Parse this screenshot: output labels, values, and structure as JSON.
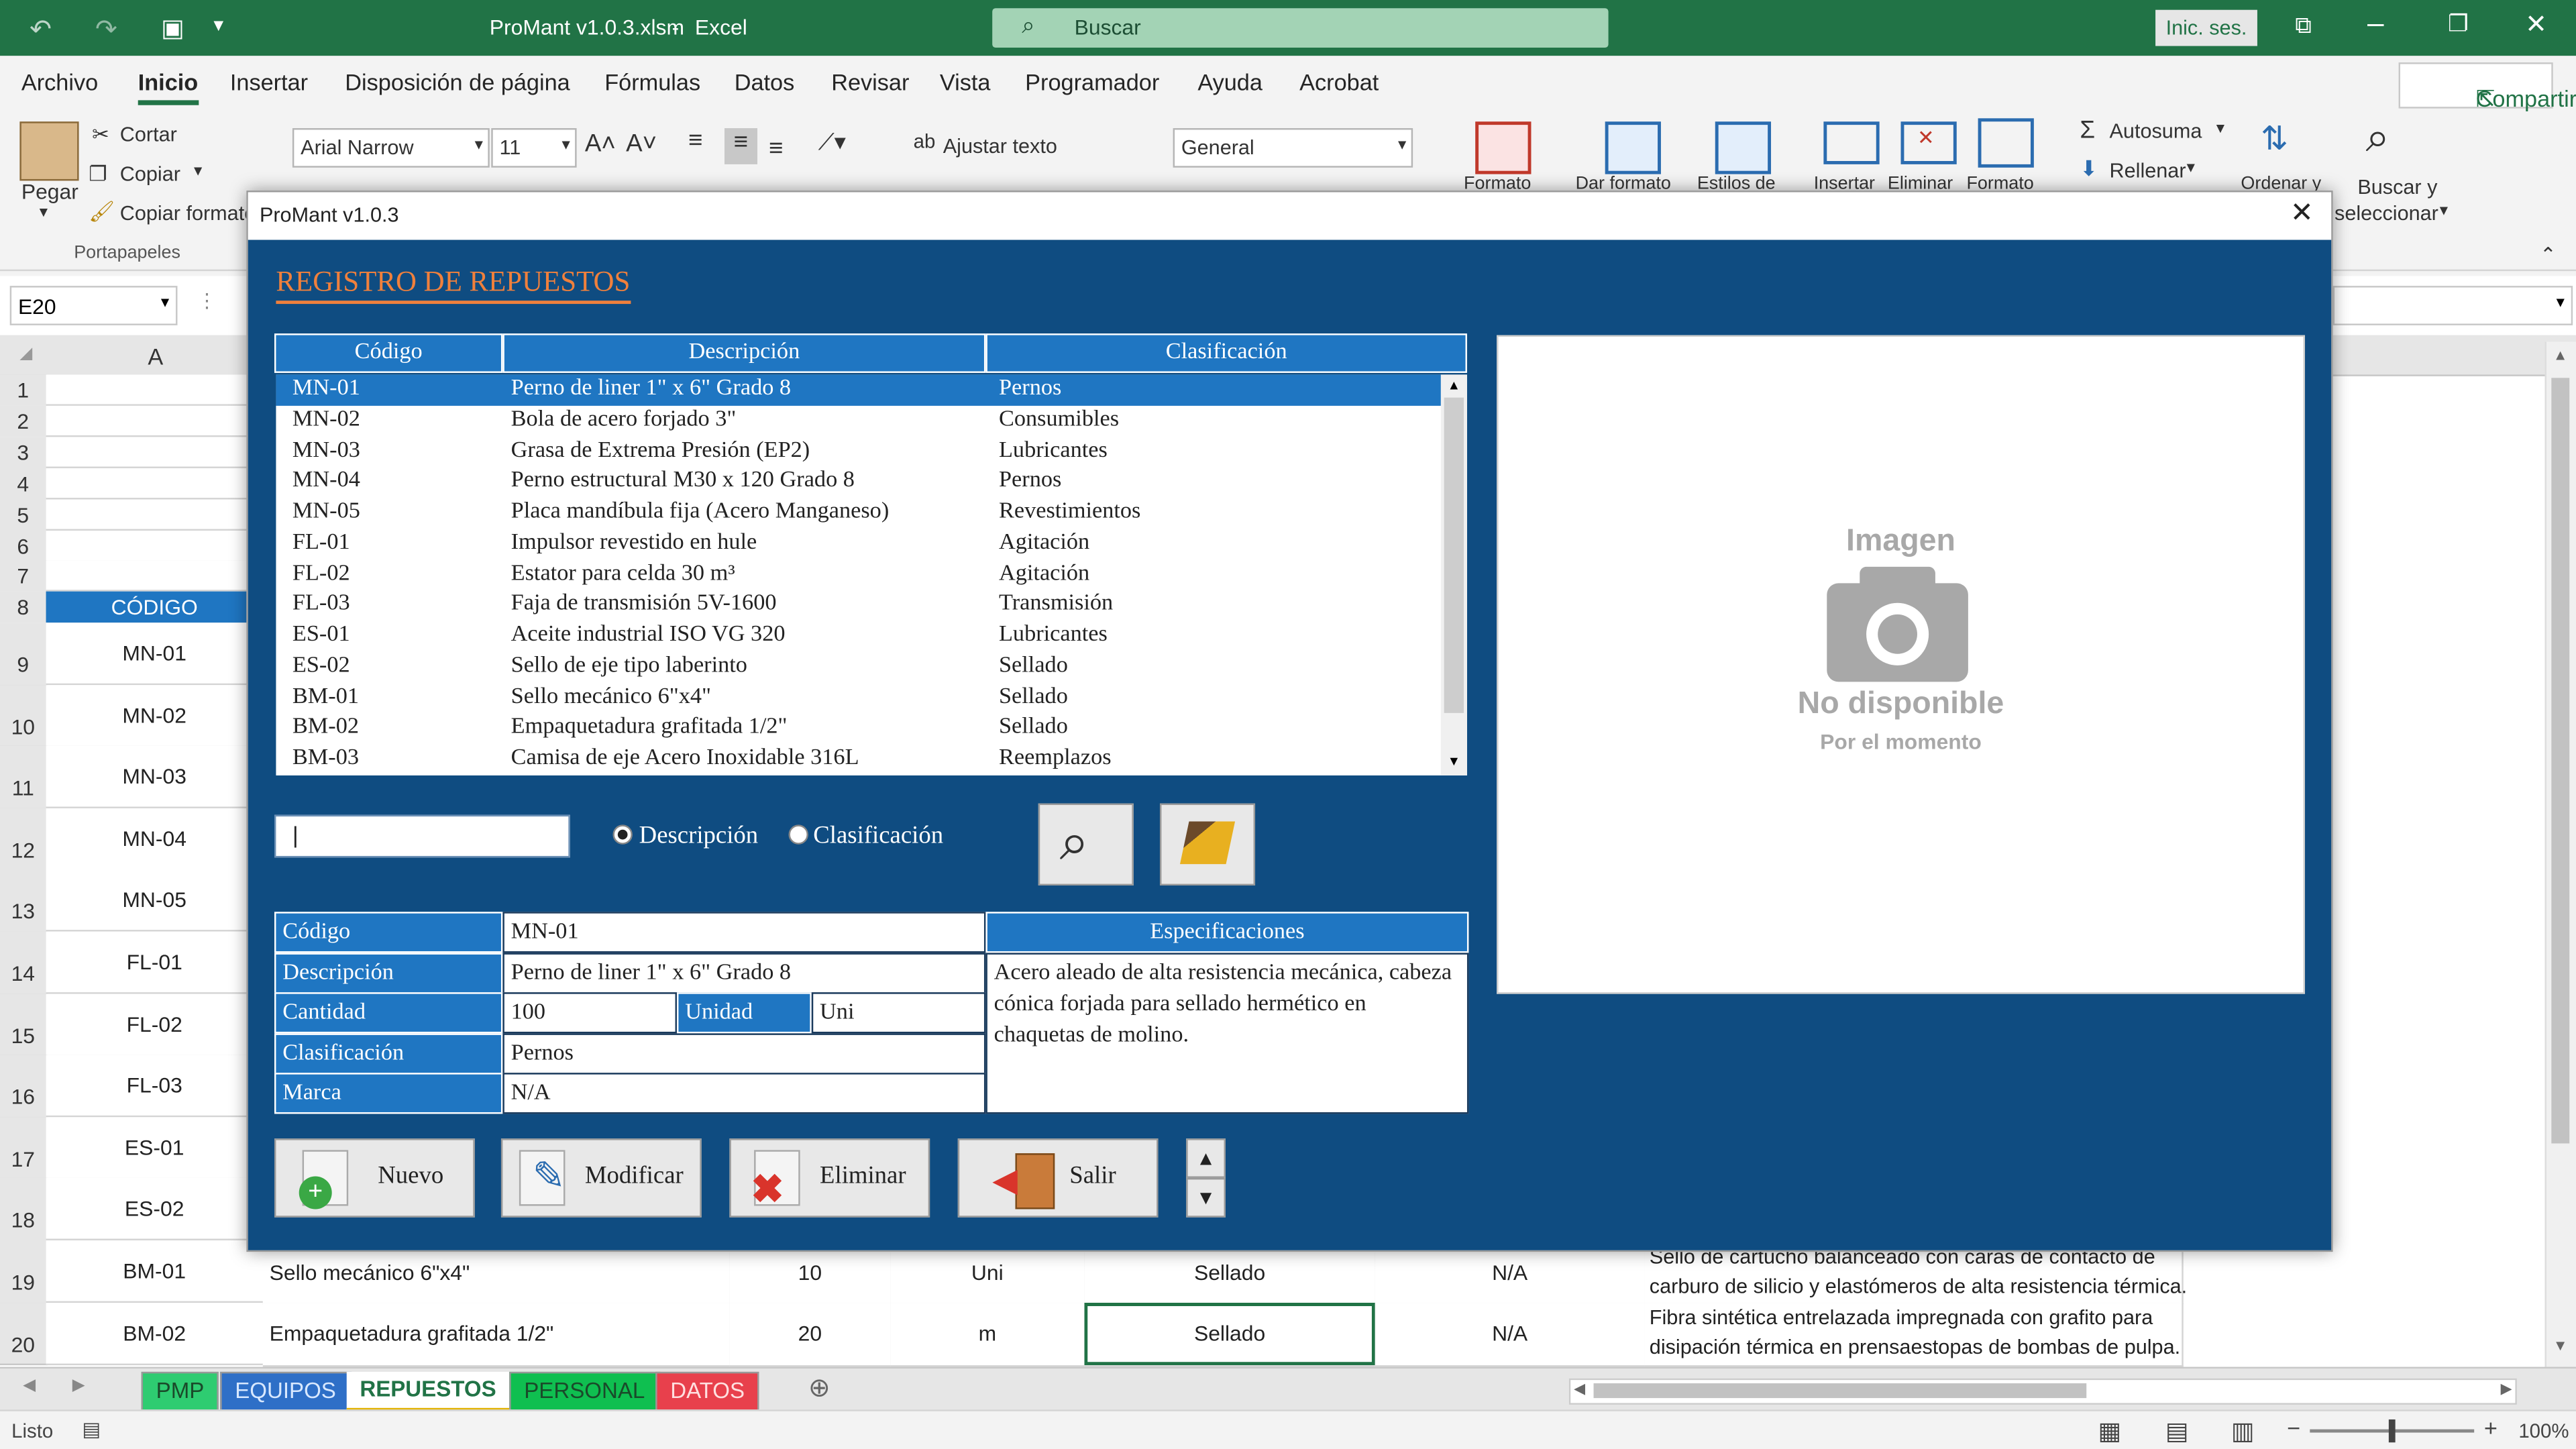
{
  "titlebar": {
    "file": "ProMant v1.0.3.xlsm",
    "sep": "-",
    "app": "Excel",
    "search_placeholder": "Buscar",
    "signin": "Inic. ses."
  },
  "menu": {
    "items": [
      "Archivo",
      "Inicio",
      "Insertar",
      "Disposición de página",
      "Fórmulas",
      "Datos",
      "Revisar",
      "Vista",
      "Programador",
      "Ayuda",
      "Acrobat"
    ],
    "share": "Compartir"
  },
  "ribbon": {
    "paste": "Pegar",
    "cut": "Cortar",
    "copy": "Copiar",
    "format_painter": "Copiar formato",
    "clipboard_group": "Portapapeles",
    "font": "Arial Narrow",
    "size": "11",
    "wrap": "Ajustar texto",
    "number_format": "General",
    "autosum": "Autosuma",
    "fill": "Rellenar",
    "find": "Buscar y",
    "select": "seleccionar",
    "fmt1": "Formato",
    "fmt2": "Dar formato",
    "fmt3": "Estilos de",
    "ins": "Insertar",
    "del": "Eliminar",
    "fmt4": "Formato",
    "order": "Ordenar y"
  },
  "namebox": "E20",
  "sheet": {
    "col_a": "A",
    "header_cell": "CÓDIGO",
    "rows": [
      "1",
      "2",
      "3",
      "4",
      "5",
      "6",
      "7",
      "8",
      "9",
      "10",
      "11",
      "12",
      "13",
      "14",
      "15",
      "16",
      "17",
      "18",
      "19",
      "20"
    ],
    "codes": [
      "MN-01",
      "MN-02",
      "MN-03",
      "MN-04",
      "MN-05",
      "FL-01",
      "FL-02",
      "FL-03",
      "ES-01",
      "ES-02",
      "BM-01",
      "BM-02"
    ],
    "row19": {
      "desc": "Sello mecánico 6\"x4\"",
      "qty": "10",
      "unit": "Uni",
      "cls": "Sellado",
      "brand": "N/A",
      "spec1": "Sello de cartucho balanceado con caras de contacto de",
      "spec2": "carburo de silicio y elastómeros de alta resistencia térmica."
    },
    "row20": {
      "desc": "Empaquetadura grafitada 1/2\"",
      "qty": "20",
      "unit": "m",
      "cls": "Sellado",
      "brand": "N/A",
      "spec1": "Fibra sintética entrelazada impregnada con grafito para",
      "spec2": "disipación térmica en prensaestopas de bombas de pulpa."
    }
  },
  "tabs": [
    "PMP",
    "EQUIPOS",
    "REPUESTOS",
    "PERSONAL",
    "DATOS"
  ],
  "status": {
    "ready": "Listo",
    "zoom": "100%",
    "minus": "−",
    "plus": "+"
  },
  "dialog": {
    "title": "ProMant v1.0.3",
    "heading": "REGISTRO DE REPUESTOS",
    "columns": [
      "Código",
      "Descripción",
      "Clasificación"
    ],
    "items": [
      [
        "MN-01",
        "Perno de liner 1\" x 6\" Grado 8",
        "Pernos"
      ],
      [
        "MN-02",
        "Bola de acero forjado 3\"",
        "Consumibles"
      ],
      [
        "MN-03",
        "Grasa de Extrema Presión (EP2)",
        "Lubricantes"
      ],
      [
        "MN-04",
        "Perno estructural M30 x 120 Grado 8",
        "Pernos"
      ],
      [
        "MN-05",
        "Placa mandíbula fija (Acero Manganeso)",
        "Revestimientos"
      ],
      [
        "FL-01",
        "Impulsor revestido en hule",
        "Agitación"
      ],
      [
        "FL-02",
        "Estator para celda 30 m³",
        "Agitación"
      ],
      [
        "FL-03",
        "Faja de transmisión 5V-1600",
        "Transmisión"
      ],
      [
        "ES-01",
        "Aceite industrial ISO VG 320",
        "Lubricantes"
      ],
      [
        "ES-02",
        "Sello de eje tipo laberinto",
        "Sellado"
      ],
      [
        "BM-01",
        "Sello mecánico 6\"x4\"",
        "Sellado"
      ],
      [
        "BM-02",
        "Empaquetadura grafitada 1/2\"",
        "Sellado"
      ],
      [
        "BM-03",
        "Camisa de eje Acero Inoxidable 316L",
        "Reemplazos"
      ]
    ],
    "search_value": "|",
    "radio_desc": "Descripción",
    "radio_cls": "Clasificación",
    "fields": {
      "codigo_l": "Código",
      "codigo": "MN-01",
      "desc_l": "Descripción",
      "desc": "Perno de liner 1\" x 6\" Grado 8",
      "cant_l": "Cantidad",
      "cant": "100",
      "unidad_l": "Unidad",
      "unidad": "Uni",
      "cls_l": "Clasificación",
      "cls": "Pernos",
      "marca_l": "Marca",
      "marca": "N/A"
    },
    "spec_label": "Especificaciones",
    "spec_text": "Acero aleado de alta resistencia mecánica, cabeza cónica forjada para sellado hermético en chaquetas de molino.",
    "image": {
      "t1": "Imagen",
      "t2": "No disponible",
      "t3": "Por el momento"
    },
    "buttons": {
      "new": "Nuevo",
      "edit": "Modificar",
      "del": "Eliminar",
      "exit": "Salir"
    }
  }
}
